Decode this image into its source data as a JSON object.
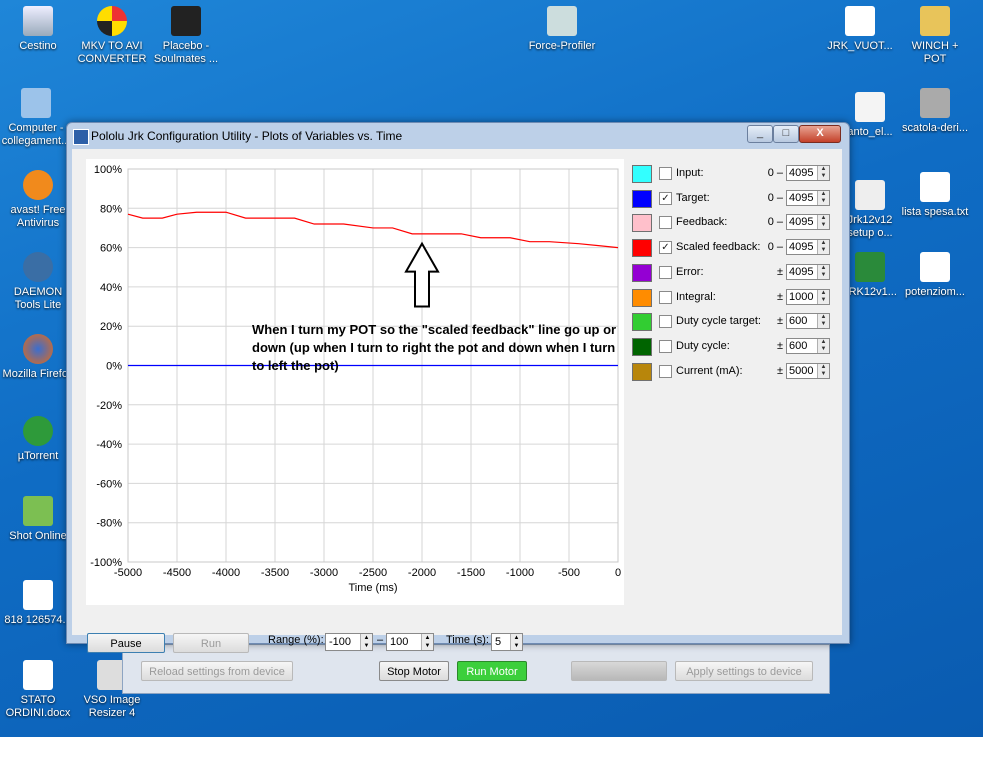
{
  "desktop": {
    "icons": [
      {
        "name": "recycle-bin",
        "label": "Cestino"
      },
      {
        "name": "mkv-to-avi",
        "label": "MKV TO AVI CONVERTER"
      },
      {
        "name": "placebo",
        "label": "Placebo - Soulmates ..."
      },
      {
        "name": "force-profiler",
        "label": "Force-Profiler"
      },
      {
        "name": "jrk-vuoto",
        "label": "JRK_VUOT..."
      },
      {
        "name": "winch-pot",
        "label": "WINCH + POT"
      },
      {
        "name": "computer",
        "label": "Computer - collegament..."
      },
      {
        "name": "anto-el",
        "label": "anto_el..."
      },
      {
        "name": "scatola-deri",
        "label": "scatola-deri..."
      },
      {
        "name": "avast",
        "label": "avast! Free Antivirus"
      },
      {
        "name": "jrk12v12",
        "label": "Jrk12v12 setup o..."
      },
      {
        "name": "lista-spesa",
        "label": "lista spesa.txt"
      },
      {
        "name": "daemon-tools",
        "label": "DAEMON Tools Lite"
      },
      {
        "name": "jrk12v1",
        "label": "JRK12v1..."
      },
      {
        "name": "potenziom",
        "label": "potenziom..."
      },
      {
        "name": "firefox",
        "label": "Mozilla Firefox"
      },
      {
        "name": "utorrent",
        "label": "µTorrent"
      },
      {
        "name": "shot-online",
        "label": "Shot Online"
      },
      {
        "name": "mp3",
        "label": "818 126574..."
      },
      {
        "name": "stato-ordini",
        "label": "STATO ORDINI.docx"
      },
      {
        "name": "vso",
        "label": "VSO Image Resizer 4"
      }
    ]
  },
  "mainwin": {
    "reload": "Reload settings from device",
    "stop": "Stop Motor",
    "run": "Run Motor",
    "apply": "Apply settings to device"
  },
  "window": {
    "title": "Pololu Jrk Configuration Utility - Plots of Variables vs. Time",
    "minimize": "_",
    "maximize": "□",
    "close": "X"
  },
  "annotation": "When I turn my POT so the \"scaled feedback\" line go up or down (up when I turn to right the pot and down when I turn to left the pot)",
  "legend": [
    {
      "label": "Input:",
      "color": "#33ffff",
      "checked": false,
      "prefix": "0 –",
      "value": "4095"
    },
    {
      "label": "Target:",
      "color": "#0000ff",
      "checked": true,
      "prefix": "0 –",
      "value": "4095"
    },
    {
      "label": "Feedback:",
      "color": "#ffc0cb",
      "checked": false,
      "prefix": "0 –",
      "value": "4095"
    },
    {
      "label": "Scaled feedback:",
      "color": "#ff0000",
      "checked": true,
      "prefix": "0 –",
      "value": "4095"
    },
    {
      "label": "Error:",
      "color": "#9400d3",
      "checked": false,
      "prefix": "±",
      "value": "4095"
    },
    {
      "label": "Integral:",
      "color": "#ff8c00",
      "checked": false,
      "prefix": "±",
      "value": "1000"
    },
    {
      "label": "Duty cycle target:",
      "color": "#32cd32",
      "checked": false,
      "prefix": "±",
      "value": "600"
    },
    {
      "label": "Duty cycle:",
      "color": "#006400",
      "checked": false,
      "prefix": "±",
      "value": "600"
    },
    {
      "label": "Current (mA):",
      "color": "#b8860b",
      "checked": false,
      "prefix": "±",
      "value": "5000"
    }
  ],
  "controls": {
    "pause": "Pause",
    "run": "Run",
    "range_label": "Range (%):",
    "range_min": "-100",
    "range_dash": "–",
    "range_max": "100",
    "time_label": "Time (s):",
    "time_value": "5"
  },
  "chart_data": {
    "type": "line",
    "xlabel": "Time (ms)",
    "ylabel": "",
    "xlim": [
      -5000,
      0
    ],
    "ylim": [
      -100,
      100
    ],
    "x_ticks": [
      "-5000",
      "-4500",
      "-4000",
      "-3500",
      "-3000",
      "-2500",
      "-2000",
      "-1500",
      "-1000",
      "-500",
      "0"
    ],
    "y_ticks": [
      "100%",
      "80%",
      "60%",
      "40%",
      "20%",
      "0%",
      "-20%",
      "-40%",
      "-60%",
      "-80%",
      "-100%"
    ],
    "grid": true,
    "series": [
      {
        "color": "#ff0000",
        "x": [
          -5000,
          -4850,
          -4650,
          -4500,
          -4300,
          -4000,
          -3800,
          -3600,
          -3300,
          -3100,
          -2800,
          -2500,
          -2300,
          -2100,
          -1900,
          -1600,
          -1400,
          -1100,
          -900,
          -700,
          -400,
          -200,
          0
        ],
        "y": [
          77,
          75,
          75,
          77,
          78,
          78,
          75,
          75,
          75,
          72,
          72,
          70,
          70,
          67,
          67,
          67,
          65,
          65,
          63,
          63,
          62,
          61,
          60
        ]
      },
      {
        "color": "#0000ff",
        "x": [
          -5000,
          0
        ],
        "y": [
          0,
          0
        ]
      }
    ]
  }
}
